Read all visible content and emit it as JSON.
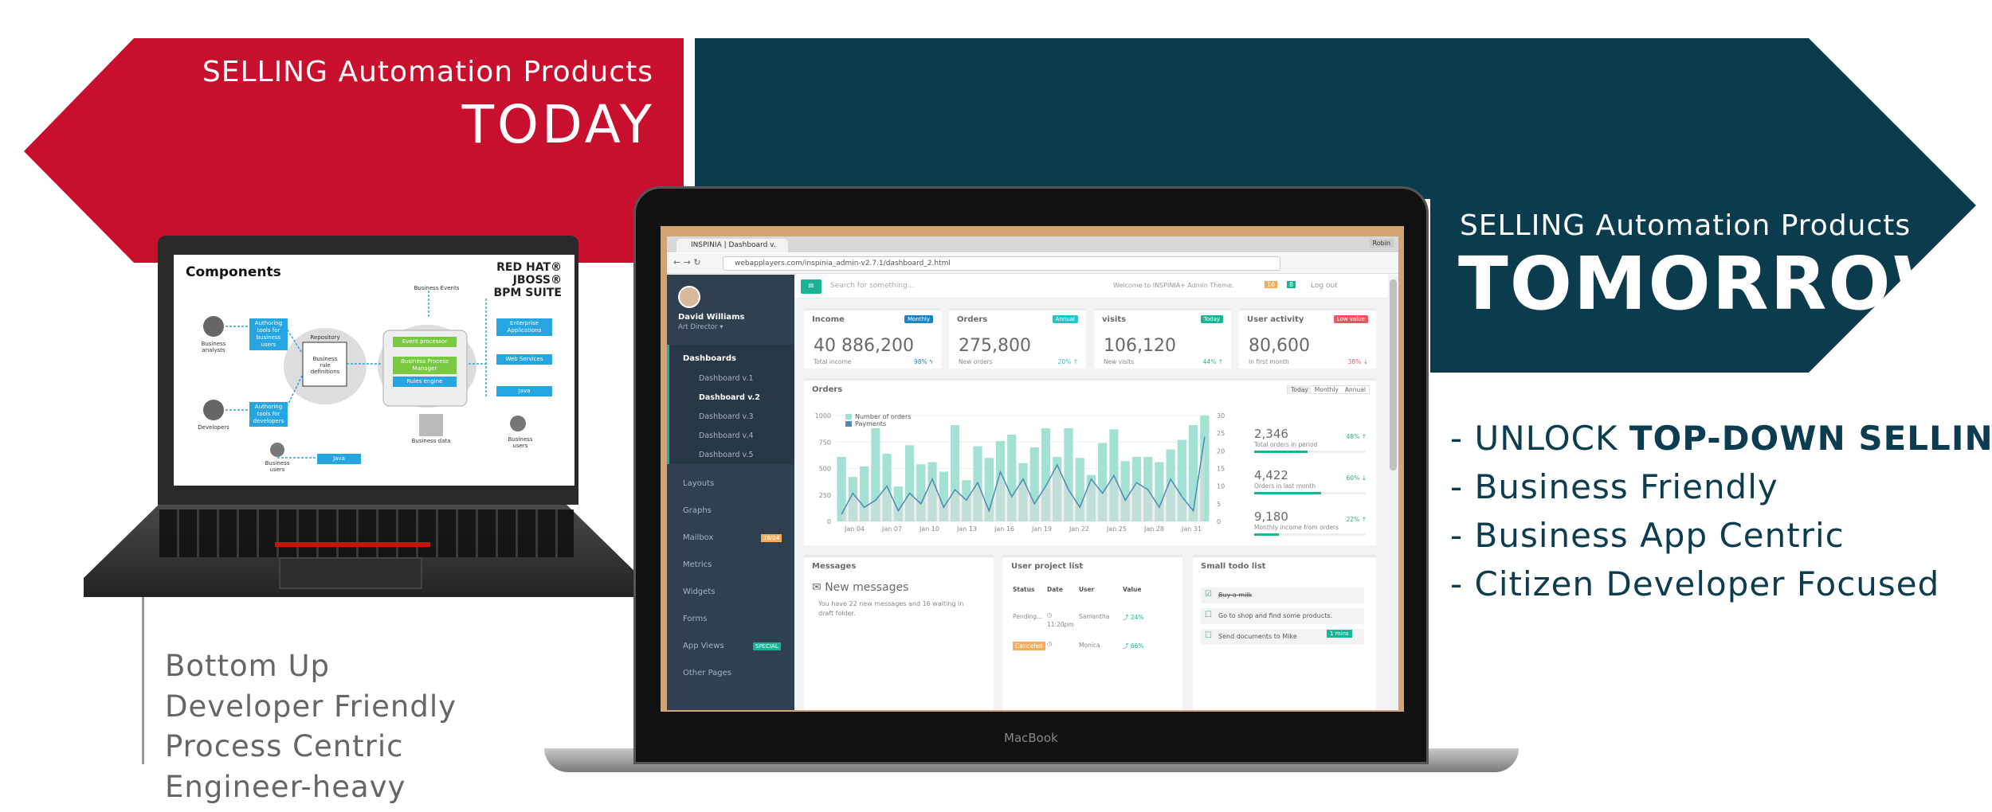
{
  "colors": {
    "red": "#c8102e",
    "blue": "#0b3c4d",
    "sidebar": "#2f4050",
    "teal": "#1ab394"
  },
  "today": {
    "line1": "SELLING Automation Products",
    "line2": "TODAY"
  },
  "tomorrow": {
    "line1": "SELLING Automation Products",
    "line2": "TOMORROW"
  },
  "bullets": {
    "b1_prefix": "- UNLOCK ",
    "b1_bold": "TOP-DOWN SELLING",
    "b2": "- Business Friendly",
    "b3": "- Business App Centric",
    "b4": "- Citizen Developer Focused"
  },
  "left_list": [
    "Bottom Up",
    "Developer Friendly",
    "Process Centric",
    "Engineer-heavy"
  ],
  "thinkpad": {
    "title": "Components",
    "logo_line1": "RED HAT® JBOSS®",
    "logo_line2": "BPM SUITE",
    "business_events": "Business Events",
    "repository": "Repository",
    "box_authoring_business": "Authoring tools for business users",
    "box_authoring_dev": "Authoring tools for developers",
    "business_analysts": "Business analysts",
    "developers": "Developers",
    "business_users_bottom": "Business users",
    "box_event": "Event processor",
    "box_bpm": "Business Process Manager",
    "box_rules": "Rules engine",
    "box_enterprise": "Enterprise Applications",
    "box_web": "Web Services",
    "box_java": "Java",
    "box_bottom": "Java",
    "business_data": "Business data",
    "business_users_right": "Business users",
    "rule_defs": "Business rule definitions"
  },
  "macbook": {
    "label": "MacBook"
  },
  "browser": {
    "tab_title": "INSPINIA | Dashboard v.",
    "url": "webapplayers.com/inspinia_admin-v2.7.1/dashboard_2.html",
    "profile": "Robin"
  },
  "sidebar": {
    "user_name": "David Williams",
    "user_role": "Art Director ▾",
    "dashboards": "Dashboards",
    "sub": [
      "Dashboard v.1",
      "Dashboard v.2",
      "Dashboard v.3",
      "Dashboard v.4",
      "Dashboard v.5"
    ],
    "items": [
      {
        "label": "Layouts",
        "badge": ""
      },
      {
        "label": "Graphs",
        "badge": ""
      },
      {
        "label": "Mailbox",
        "badge": "16/24"
      },
      {
        "label": "Metrics",
        "badge": ""
      },
      {
        "label": "Widgets",
        "badge": ""
      },
      {
        "label": "Forms",
        "badge": ""
      },
      {
        "label": "App Views",
        "badge": "SPECIAL"
      },
      {
        "label": "Other Pages",
        "badge": ""
      }
    ]
  },
  "topbar": {
    "search_placeholder": "Search for something...",
    "welcome": "Welcome to INSPINIA+ Admin Theme.",
    "logout": "Log out",
    "badge1": "16",
    "badge2": "8"
  },
  "stats": [
    {
      "title": "Income",
      "badge": "Monthly",
      "badge_color": "#1c84c6",
      "value": "40 886,200",
      "sub": "Total income",
      "pct": "98% ϟ",
      "pct_color": "#1c84c6",
      "bar": 0
    },
    {
      "title": "Orders",
      "badge": "Annual",
      "badge_color": "#23c6c8",
      "value": "275,800",
      "sub": "New orders",
      "pct": "20% ↑",
      "pct_color": "#23c6c8",
      "bar": 0
    },
    {
      "title": "visits",
      "badge": "Today",
      "badge_color": "#1ab394",
      "value": "106,120",
      "sub": "New visits",
      "pct": "44% ↑",
      "pct_color": "#1ab394",
      "bar": 0
    },
    {
      "title": "User activity",
      "badge": "Low value",
      "badge_color": "#ed5565",
      "value": "80,600",
      "sub": "In first month",
      "pct": "38% ↓",
      "pct_color": "#ed5565",
      "bar": 0
    }
  ],
  "orders_panel": {
    "title": "Orders",
    "tabs": [
      "Today",
      "Monthly",
      "Annual"
    ],
    "legend": [
      "Number of orders",
      "Payments"
    ],
    "side": [
      {
        "value": "2,346",
        "label": "Total orders in period",
        "pct": "48% ↑",
        "fill": 0.48
      },
      {
        "value": "4,422",
        "label": "Orders in last month",
        "pct": "60% ↓",
        "fill": 0.6
      },
      {
        "value": "9,180",
        "label": "Monthly income from orders",
        "pct": "22% ↑",
        "fill": 0.22
      }
    ]
  },
  "chart_data": {
    "type": "bar",
    "categories": [
      "Jan 04",
      "Jan 07",
      "Jan 10",
      "Jan 13",
      "Jan 16",
      "Jan 19",
      "Jan 22",
      "Jan 25",
      "Jan 28",
      "Jan 31"
    ],
    "ylim_left": [
      0,
      1000
    ],
    "ylim_right": [
      0,
      30
    ],
    "yticks_left": [
      "0",
      "250",
      "500",
      "750",
      "1000"
    ],
    "yticks_right": [
      "0",
      "5",
      "10",
      "15",
      "20",
      "25",
      "30"
    ],
    "series": [
      {
        "name": "Number of orders",
        "values": [
          610,
          420,
          520,
          880,
          640,
          330,
          720,
          540,
          560,
          470,
          910,
          390,
          710,
          600,
          760,
          820,
          550,
          700,
          880,
          610,
          880,
          600,
          440,
          740,
          870,
          570,
          610,
          610,
          560,
          680,
          770,
          910,
          1000
        ]
      },
      {
        "name": "Payments",
        "values": [
          2,
          8,
          4,
          6,
          10,
          3,
          8,
          5,
          12,
          4,
          9,
          6,
          11,
          3,
          14,
          7,
          12,
          5,
          10,
          16,
          9,
          4,
          12,
          8,
          13,
          6,
          11,
          9,
          4,
          12,
          7,
          3,
          24
        ]
      }
    ]
  },
  "messages": {
    "title": "Messages",
    "heading": "New messages",
    "body": "You have 22 new messages and 16 waiting in draft folder."
  },
  "projects": {
    "title": "User project list",
    "headers": [
      "Status",
      "Date",
      "User",
      "Value"
    ],
    "rows": [
      {
        "status": "Pending...",
        "date": "11:20pm",
        "user": "Samantha",
        "value": "24%"
      },
      {
        "status": "Canceled",
        "date": "",
        "user": "Monica",
        "value": "66%"
      }
    ]
  },
  "todo": {
    "title": "Small todo list",
    "items": [
      "Buy a milk",
      "Go to shop and find some products.",
      "Send documents to Mike"
    ],
    "tag": "1 mins"
  }
}
